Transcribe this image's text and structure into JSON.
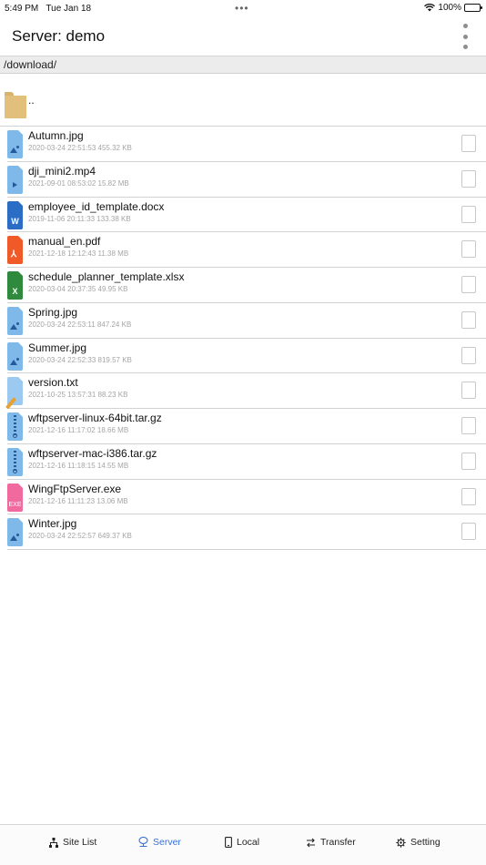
{
  "status_bar": {
    "time": "5:49 PM",
    "date": "Tue Jan 18",
    "battery": "100%",
    "dots": "•••"
  },
  "nav": {
    "title": "Server: demo"
  },
  "path": "/download/",
  "parent_row": {
    "name": ".."
  },
  "files": [
    {
      "name": "Autumn.jpg",
      "meta": "2020-03-24 22:51:53  455.32 KB",
      "icon": "image-file-icon",
      "type": "image"
    },
    {
      "name": "dji_mini2.mp4",
      "meta": "2021-09-01 08:53:02  15.82 MB",
      "icon": "video-file-icon",
      "type": "video"
    },
    {
      "name": "employee_id_template.docx",
      "meta": "2019-11-06 20:11:33  133.38 KB",
      "icon": "word-file-icon",
      "type": "word",
      "glyph": "W"
    },
    {
      "name": "manual_en.pdf",
      "meta": "2021-12-18 12:12:43  11.38 MB",
      "icon": "pdf-file-icon",
      "type": "pdf"
    },
    {
      "name": "schedule_planner_template.xlsx",
      "meta": "2020-03-04 20:37:35  49.95 KB",
      "icon": "excel-file-icon",
      "type": "excel",
      "glyph": "X"
    },
    {
      "name": "Spring.jpg",
      "meta": "2020-03-24 22:53:11  847.24 KB",
      "icon": "image-file-icon",
      "type": "image"
    },
    {
      "name": "Summer.jpg",
      "meta": "2020-03-24 22:52:33  819.57 KB",
      "icon": "image-file-icon",
      "type": "image"
    },
    {
      "name": "version.txt",
      "meta": "2021-10-25 13:57:31  88.23 KB",
      "icon": "text-file-icon",
      "type": "text"
    },
    {
      "name": "wftpserver-linux-64bit.tar.gz",
      "meta": "2021-12-16 11:17:02  18.66 MB",
      "icon": "archive-file-icon",
      "type": "archive"
    },
    {
      "name": "wftpserver-mac-i386.tar.gz",
      "meta": "2021-12-16 11:18:15  14.55 MB",
      "icon": "archive-file-icon",
      "type": "archive"
    },
    {
      "name": "WingFtpServer.exe",
      "meta": "2021-12-16 11:11:23  13.06 MB",
      "icon": "exe-file-icon",
      "type": "exe",
      "glyph": "EXE"
    },
    {
      "name": "Winter.jpg",
      "meta": "2020-03-24 22:52:57  649.37 KB",
      "icon": "image-file-icon",
      "type": "image"
    }
  ],
  "tabs": [
    {
      "label": "Site List",
      "icon": "sitemap-icon",
      "active": false
    },
    {
      "label": "Server",
      "icon": "server-icon",
      "active": true
    },
    {
      "label": "Local",
      "icon": "phone-icon",
      "active": false
    },
    {
      "label": "Transfer",
      "icon": "transfer-arrows-icon",
      "active": false
    },
    {
      "label": "Setting",
      "icon": "gear-icon",
      "active": false
    }
  ],
  "colors": {
    "accent": "#3a6fd8",
    "folder": "#e2bf7b"
  }
}
